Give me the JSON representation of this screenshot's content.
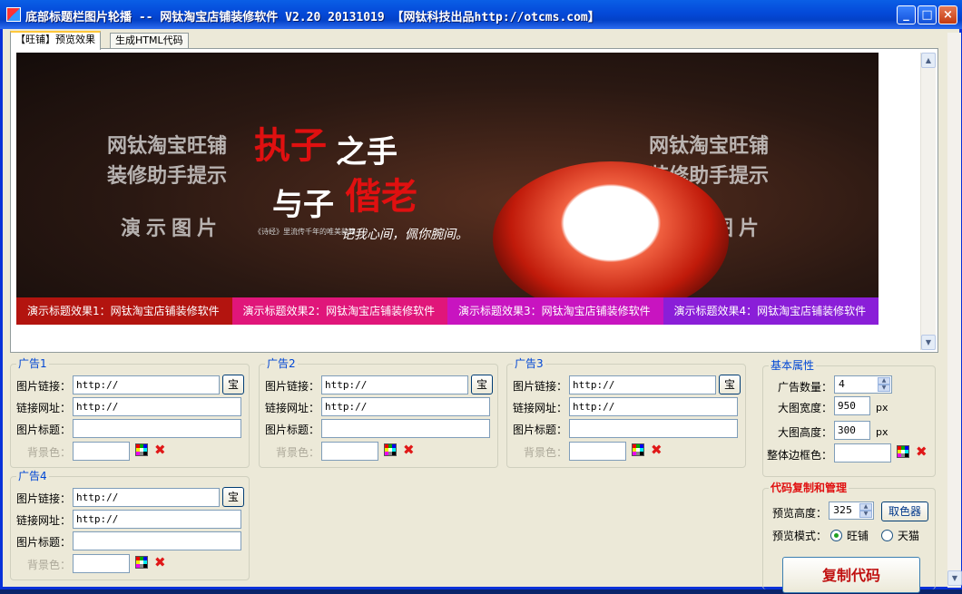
{
  "window": {
    "title": "底部标题栏图片轮播 -- 网钛淘宝店铺装修软件 V2.20 20131019 【网钛科技出品http://otcms.com】",
    "min_label": "_",
    "max_label": "□",
    "close_label": "×"
  },
  "tabs": [
    {
      "label": "【旺铺】预览效果",
      "active": true
    },
    {
      "label": "生成HTML代码",
      "active": false
    }
  ],
  "banner": {
    "watermark_left_1": "网钛淘宝旺铺",
    "watermark_left_2": "装修助手提示",
    "watermark_left_3": "演示图片",
    "watermark_right_1": "网钛淘宝旺铺",
    "watermark_right_2": "装修助手提示",
    "watermark_right_3": "演示图片",
    "slogan_1": "执子",
    "slogan_2": "之手",
    "slogan_3": "与子",
    "slogan_4": "偕老",
    "sub_small": "《诗经》里流传千年的唯美韵籍",
    "sub_script": "记我心间，佩你腕间。",
    "captions": [
      {
        "text": "演示标题效果1：网钛淘宝店铺装修软件",
        "color": "#b3140f"
      },
      {
        "text": "演示标题效果2：网钛淘宝店铺装修软件",
        "color": "#e0167a"
      },
      {
        "text": "演示标题效果3：网钛淘宝店铺装修软件",
        "color": "#c814c0"
      },
      {
        "text": "演示标题效果4：网钛淘宝店铺装修软件",
        "color": "#8a1ed8"
      }
    ]
  },
  "labels": {
    "img_link": "图片链接：",
    "link_url": "链接网址：",
    "img_title": "图片标题：",
    "bg_color": "背景色：",
    "bao": "宝",
    "remove": "✖"
  },
  "ads": [
    {
      "label": "广告1",
      "img_link": "http://",
      "link_url": "http://",
      "img_title": "",
      "bg_color": ""
    },
    {
      "label": "广告2",
      "img_link": "http://",
      "link_url": "http://",
      "img_title": "",
      "bg_color": ""
    },
    {
      "label": "广告3",
      "img_link": "http://",
      "link_url": "http://",
      "img_title": "",
      "bg_color": ""
    },
    {
      "label": "广告4",
      "img_link": "http://",
      "link_url": "http://",
      "img_title": "",
      "bg_color": ""
    }
  ],
  "basic": {
    "title": "基本属性",
    "count_label": "广告数量：",
    "count_value": "4",
    "width_label": "大图宽度：",
    "width_value": "950",
    "height_label": "大图高度：",
    "height_value": "300",
    "unit": "px",
    "border_label": "整体边框色：",
    "border_value": ""
  },
  "code": {
    "title": "代码复制和管理",
    "preview_height_label": "预览高度：",
    "preview_height_value": "325",
    "picker_label": "取色器",
    "mode_label": "预览模式：",
    "mode_wangpu": "旺铺",
    "mode_tmall": "天猫",
    "copy_label": "复制代码"
  }
}
